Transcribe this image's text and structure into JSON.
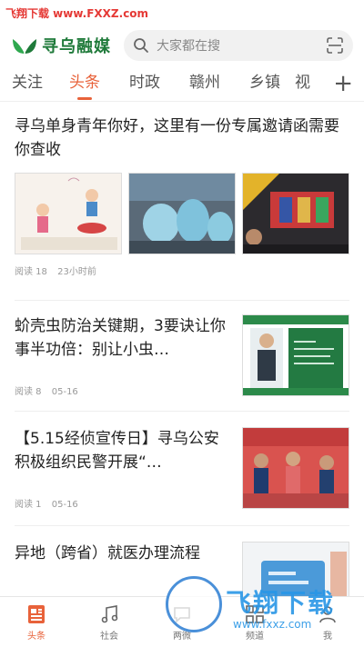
{
  "watermark": {
    "top_text": "飞翔下载 www.FXXZ.com",
    "logo_title": "飞翔下载",
    "logo_url": "www.fxxz.com"
  },
  "header": {
    "app_name": "寻乌融媒",
    "search_placeholder": "大家都在搜"
  },
  "tabs": [
    "关注",
    "头条",
    "时政",
    "赣州",
    "乡镇",
    "视"
  ],
  "active_tab": "头条",
  "articles": [
    {
      "title": "寻乌单身青年你好，这里有一份专属邀请函需要你查收",
      "reads": "阅读 18",
      "time": "23小时前"
    },
    {
      "title": "蚧壳虫防治关键期，3要诀让你事半功倍：别让小虫…",
      "reads": "阅读 8",
      "time": "05-16"
    },
    {
      "title": "【5.15经侦宣传日】寻乌公安积极组织民警开展“…",
      "reads": "阅读 1",
      "time": "05-16"
    },
    {
      "title": "异地（跨省）就医办理流程",
      "reads": "",
      "time": ""
    }
  ],
  "bottom_nav": [
    "头条",
    "社会",
    "两微",
    "频道",
    "我"
  ],
  "colors": {
    "accent": "#e8623a",
    "brand_green": "#1f7a3a",
    "watermark_red": "#e53935"
  }
}
